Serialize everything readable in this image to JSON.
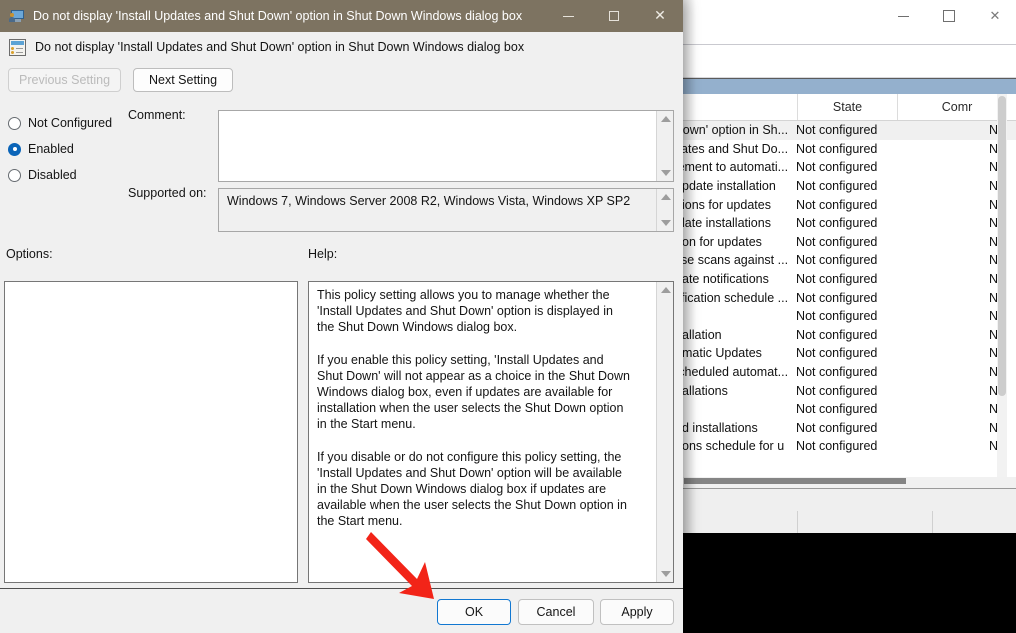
{
  "dialog": {
    "title": "Do not display 'Install Updates and Shut Down' option in Shut Down Windows dialog box",
    "header_text": "Do not display 'Install Updates and Shut Down' option in Shut Down Windows dialog box",
    "window_controls": {
      "minimize": "—",
      "maximize": "□",
      "close": "✕"
    },
    "nav": {
      "previous_label": "Previous Setting",
      "next_label": "Next Setting"
    },
    "radios": [
      {
        "label": "Not Configured",
        "checked": false
      },
      {
        "label": "Enabled",
        "checked": true
      },
      {
        "label": "Disabled",
        "checked": false
      }
    ],
    "comment": {
      "label": "Comment:",
      "value": "",
      "placeholder": ""
    },
    "supported_on": {
      "label": "Supported on:",
      "value": "Windows 7, Windows Server 2008 R2, Windows Vista, Windows XP SP2"
    },
    "options": {
      "label": "Options:",
      "value": ""
    },
    "help": {
      "label": "Help:",
      "paragraphs": [
        "This policy setting allows you to manage whether the 'Install Updates and Shut Down' option is displayed in the Shut Down Windows dialog box.",
        "If you enable this policy setting, 'Install Updates and Shut Down' will not appear as a choice in the Shut Down Windows dialog box, even if updates are available for installation when the user selects the Shut Down option in the Start menu.",
        "If you disable or do not configure this policy setting, the 'Install Updates and Shut Down' option will be available in the Shut Down Windows dialog box if updates are available when the user selects the Shut Down option in the Start menu."
      ]
    },
    "footer": {
      "ok_label": "OK",
      "cancel_label": "Cancel",
      "apply_label": "Apply"
    }
  },
  "background": {
    "window_controls": {
      "minimize": "—",
      "maximize": "□",
      "close": "✕"
    },
    "columns": [
      "",
      "State",
      "Comr"
    ],
    "rows": [
      {
        "name": "Down' option in Sh...",
        "state": "Not configured",
        "comment": "N",
        "selected": true
      },
      {
        "name": "dates and Shut Do...",
        "state": "Not configured",
        "comment": "N",
        "selected": false
      },
      {
        "name": "ement to automati...",
        "state": "Not configured",
        "comment": "N",
        "selected": false
      },
      {
        "name": "pdate installation",
        "state": "Not configured",
        "comment": "N",
        "selected": false
      },
      {
        "name": "ions for updates",
        "state": "Not configured",
        "comment": "N",
        "selected": false
      },
      {
        "name": "late installations",
        "state": "Not configured",
        "comment": "N",
        "selected": false
      },
      {
        "name": "on for updates",
        "state": "Not configured",
        "comment": "N",
        "selected": false
      },
      {
        "name": "ause scans against ...",
        "state": "Not configured",
        "comment": "N",
        "selected": false
      },
      {
        "name": "ate notifications",
        "state": "Not configured",
        "comment": "N",
        "selected": false
      },
      {
        "name": "tification schedule ...",
        "state": "Not configured",
        "comment": "N",
        "selected": false
      },
      {
        "name": "",
        "state": "Not configured",
        "comment": "N",
        "selected": false
      },
      {
        "name": "allation",
        "state": "Not configured",
        "comment": "N",
        "selected": false
      },
      {
        "name": "matic Updates",
        "state": "Not configured",
        "comment": "N",
        "selected": false
      },
      {
        "name": "scheduled automat...",
        "state": "Not configured",
        "comment": "N",
        "selected": false
      },
      {
        "name": "allations",
        "state": "Not configured",
        "comment": "N",
        "selected": false
      },
      {
        "name": "",
        "state": "Not configured",
        "comment": "N",
        "selected": false
      },
      {
        "name": "d installations",
        "state": "Not configured",
        "comment": "N",
        "selected": false
      },
      {
        "name": "ons schedule for u",
        "state": "Not configured",
        "comment": "N",
        "selected": false
      }
    ]
  },
  "annotation": {
    "arrow_color": "#f22418",
    "type": "red-arrow-pointing-to-ok-button"
  },
  "colors": {
    "dialog_titlebar": "#7d7361",
    "dialog_face": "#f0f0f0",
    "accent_blue": "#0a64b8",
    "ok_button_border": "#1177d1",
    "selection_band": "#94b0cd",
    "annotation_red": "#f22418"
  }
}
